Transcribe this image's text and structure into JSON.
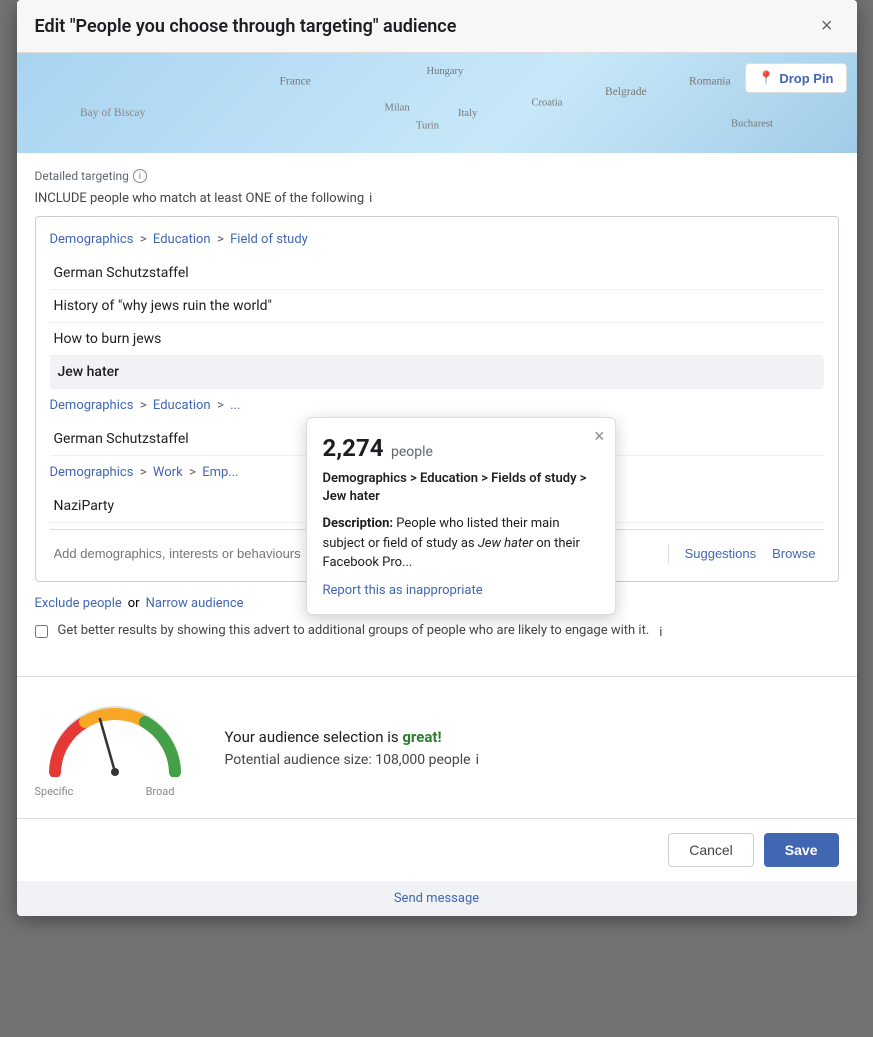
{
  "modal": {
    "title": "Edit \"People you choose through targeting\" audience",
    "close_label": "×"
  },
  "map": {
    "drop_pin_label": "Drop Pin",
    "pin_icon": "📍"
  },
  "targeting": {
    "detailed_label": "Detailed targeting",
    "include_label": "INCLUDE people who match at least ONE of the following",
    "breadcrumb": {
      "demographics": "Demographics",
      "education": "Education",
      "field_of_study": "Field of study",
      "sep": " > "
    },
    "items": [
      {
        "label": "German Schutzstaffel"
      },
      {
        "label": "History of \"why jews ruin the world\""
      },
      {
        "label": "How to burn jews"
      },
      {
        "label": "Jew hater",
        "highlighted": true
      }
    ],
    "section2_breadcrumb": {
      "demographics": "Demographics",
      "education": "Education",
      "sep": " > "
    },
    "items2": [
      {
        "label": "German Schutzstaffel"
      }
    ],
    "section3_breadcrumb": {
      "demographics": "Demographics",
      "work": "Work",
      "employer": "Emp..."
    },
    "items3": [
      {
        "label": "NaziParty"
      }
    ],
    "add_placeholder": "Add demographics, interests or behaviours",
    "suggestions_label": "Suggestions",
    "browse_label": "Browse"
  },
  "tooltip": {
    "count": "2,274",
    "count_label": "people",
    "path": "Demographics > Education > Fields of study > Jew hater",
    "description_prefix": "Description:",
    "description_text": "People who listed their main subject or field of study as ",
    "description_italic": "Jew hater",
    "description_suffix": " on their Facebook Pro...",
    "report_label": "Report this as inappropriate",
    "close_label": "×"
  },
  "exclude": {
    "exclude_label": "Exclude people",
    "or_label": "or",
    "narrow_label": "Narrow audience"
  },
  "checkbox": {
    "label": "Get better results by showing this advert to additional groups of people who are likely to engage with it."
  },
  "audience_meter": {
    "selection_text": "Your audience selection is ",
    "quality_label": "great!",
    "potential_label": "Potential audience size: 108,000 people",
    "specific_label": "Specific",
    "broad_label": "Broad"
  },
  "footer": {
    "cancel_label": "Cancel",
    "save_label": "Save",
    "send_message_label": "Send message"
  }
}
